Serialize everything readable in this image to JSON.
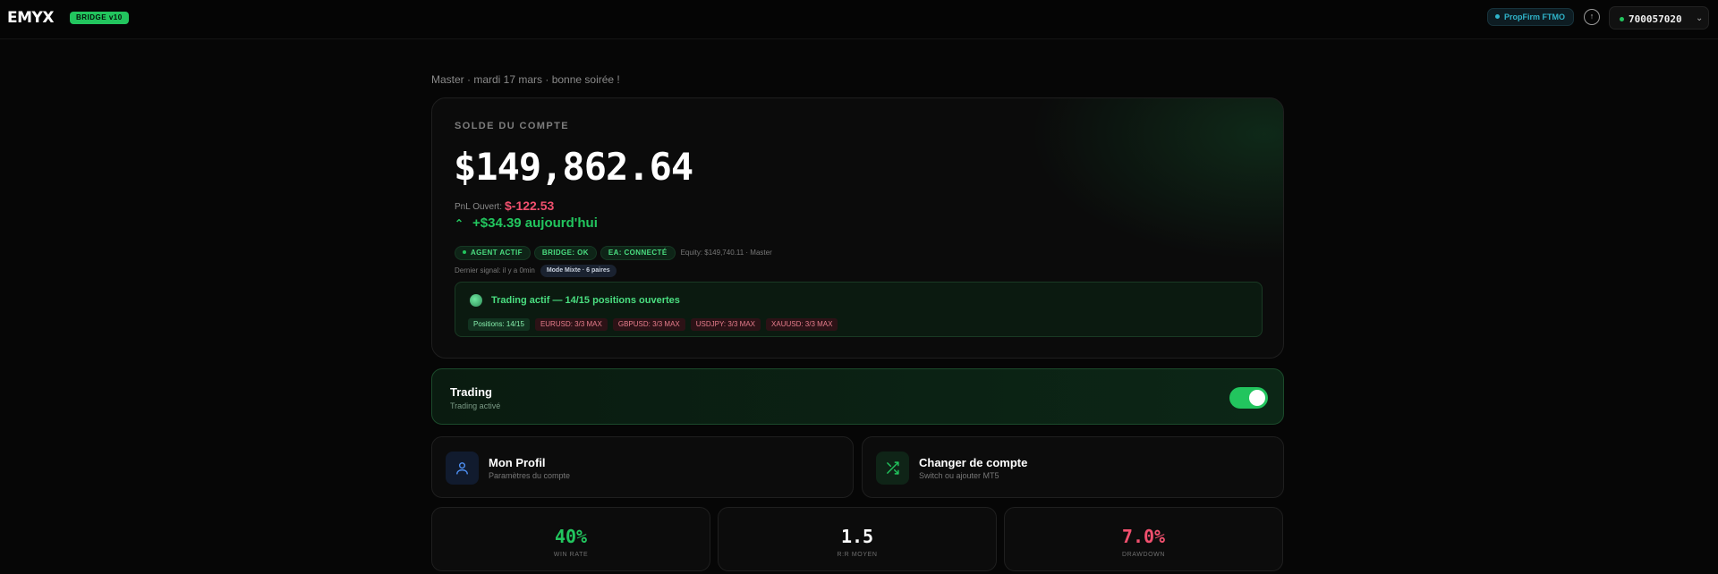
{
  "header": {
    "logo": "EMYX",
    "version": "BRIDGE v10",
    "propfirm": "PropFirm FTMO",
    "help_icon": "info-icon",
    "account_number": "700057020",
    "account_chevron": "chevron-down-icon"
  },
  "greeting": "Master · mardi 17 mars · bonne soirée !",
  "balance": {
    "label": "SOLDE DU COMPTE",
    "value": "$149,862.64",
    "pnl_label": "PnL Ouvert:",
    "pnl_value": "$-122.53",
    "today": "+$34.39 aujourd'hui",
    "badges": [
      "AGENT ACTIF",
      "BRIDGE: OK",
      "EA: CONNECTÉ"
    ],
    "equity": "Equity: $149,740.11 · Master",
    "signal": "Dernier signal: il y a 0min",
    "mode": "Mode Mixte · 6 paires",
    "trading_status": "Trading actif — 14/15 positions ouvertes",
    "chips": {
      "positions": "Positions: 14/15",
      "eurusd": "EURUSD: 3/3 MAX",
      "gbpusd": "GBPUSD: 3/3 MAX",
      "usdjpy": "USDJPY: 3/3 MAX",
      "xauusd": "XAUUSD: 3/3 MAX"
    }
  },
  "trading_toggle": {
    "title": "Trading",
    "subtitle": "Trading activé",
    "enabled": true
  },
  "nav": {
    "profile": {
      "title": "Mon Profil",
      "subtitle": "Paramètres du compte",
      "icon": "user-icon"
    },
    "switch": {
      "title": "Changer de compte",
      "subtitle": "Switch ou ajouter MT5",
      "icon": "shuffle-icon"
    }
  },
  "stats": [
    {
      "value": "40%",
      "label": "WIN RATE",
      "color": "#22c55e"
    },
    {
      "value": "1.5",
      "label": "R:R MOYEN",
      "color": "#ffffff"
    },
    {
      "value": "7.0%",
      "label": "DRAWDOWN",
      "color": "#f0506e"
    }
  ],
  "colors": {
    "accent": "#22c55e",
    "negative": "#f0506e",
    "background": "#060606"
  }
}
